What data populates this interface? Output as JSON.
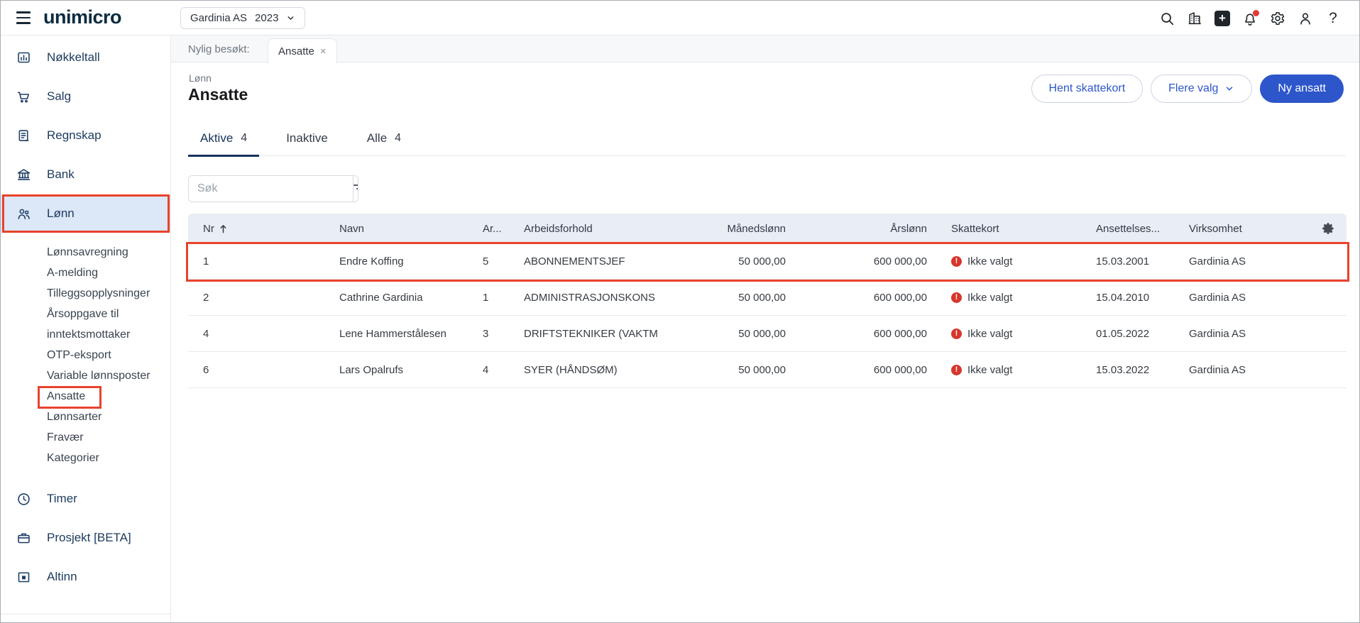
{
  "topbar": {
    "logo": "unimicro",
    "company": "Gardinia AS",
    "year": "2023"
  },
  "sidebar": {
    "items": [
      {
        "label": "Nøkkeltall"
      },
      {
        "label": "Salg"
      },
      {
        "label": "Regnskap"
      },
      {
        "label": "Bank"
      },
      {
        "label": "Lønn"
      }
    ],
    "lonn_children": [
      "Lønnsavregning",
      "A-melding",
      "Tilleggsopplysninger",
      "Årsoppgave til inntektsmottaker",
      "OTP-eksport",
      "Variable lønnsposter",
      "Ansatte",
      "Lønnsarter",
      "Fravær",
      "Kategorier"
    ],
    "items_bottom": [
      {
        "label": "Timer"
      },
      {
        "label": "Prosjekt [BETA]"
      },
      {
        "label": "Altinn"
      }
    ]
  },
  "recent": {
    "label": "Nylig besøkt:",
    "tab": "Ansatte",
    "close": "×"
  },
  "page": {
    "breadcrumb": "Lønn",
    "title": "Ansatte"
  },
  "actions": {
    "fetch_taxcards": "Hent skattekort",
    "more_options": "Flere valg",
    "new_employee": "Ny ansatt"
  },
  "filter_tabs": {
    "active": {
      "label": "Aktive",
      "count": "4"
    },
    "inactive": {
      "label": "Inaktive"
    },
    "all": {
      "label": "Alle",
      "count": "4"
    }
  },
  "search": {
    "placeholder": "Søk"
  },
  "table": {
    "columns": {
      "nr": "Nr",
      "navn": "Navn",
      "ar": "Ar...",
      "arbeidsforhold": "Arbeidsforhold",
      "manedslonn": "Månedslønn",
      "arslonn": "Årslønn",
      "skattekort": "Skattekort",
      "ansettelsesdato": "Ansettelses...",
      "virksomhet": "Virksomhet"
    },
    "rows": [
      {
        "nr": "1",
        "navn": "Endre Koffing",
        "ar": "5",
        "arbeidsforhold": "ABONNEMENTSJEF",
        "manedslonn": "50 000,00",
        "arslonn": "600 000,00",
        "skattekort": "Ikke valgt",
        "ansettelsesdato": "15.03.2001",
        "virksomhet": "Gardinia AS",
        "highlighted": true
      },
      {
        "nr": "2",
        "navn": "Cathrine Gardinia",
        "ar": "1",
        "arbeidsforhold": "ADMINISTRASJONSKONS",
        "manedslonn": "50 000,00",
        "arslonn": "600 000,00",
        "skattekort": "Ikke valgt",
        "ansettelsesdato": "15.04.2010",
        "virksomhet": "Gardinia AS",
        "highlighted": false
      },
      {
        "nr": "4",
        "navn": "Lene Hammerstålesen",
        "ar": "3",
        "arbeidsforhold": "DRIFTSTEKNIKER (VAKTM",
        "manedslonn": "50 000,00",
        "arslonn": "600 000,00",
        "skattekort": "Ikke valgt",
        "ansettelsesdato": "01.05.2022",
        "virksomhet": "Gardinia AS",
        "highlighted": false
      },
      {
        "nr": "6",
        "navn": "Lars Opalrufs",
        "ar": "4",
        "arbeidsforhold": "SYER (HÅNDSØM)",
        "manedslonn": "50 000,00",
        "arslonn": "600 000,00",
        "skattekort": "Ikke valgt",
        "ansettelsesdato": "15.03.2022",
        "virksomhet": "Gardinia AS",
        "highlighted": false
      }
    ]
  },
  "colors": {
    "accent_blue": "#2d56cb",
    "annotation_red": "#e8432d",
    "error_red": "#d6362c",
    "sidebar_navy": "#1c3a5e",
    "active_item_bg": "#dce7f7",
    "table_header_bg": "#e9edf4",
    "strip_bg": "#f7f8f9"
  }
}
